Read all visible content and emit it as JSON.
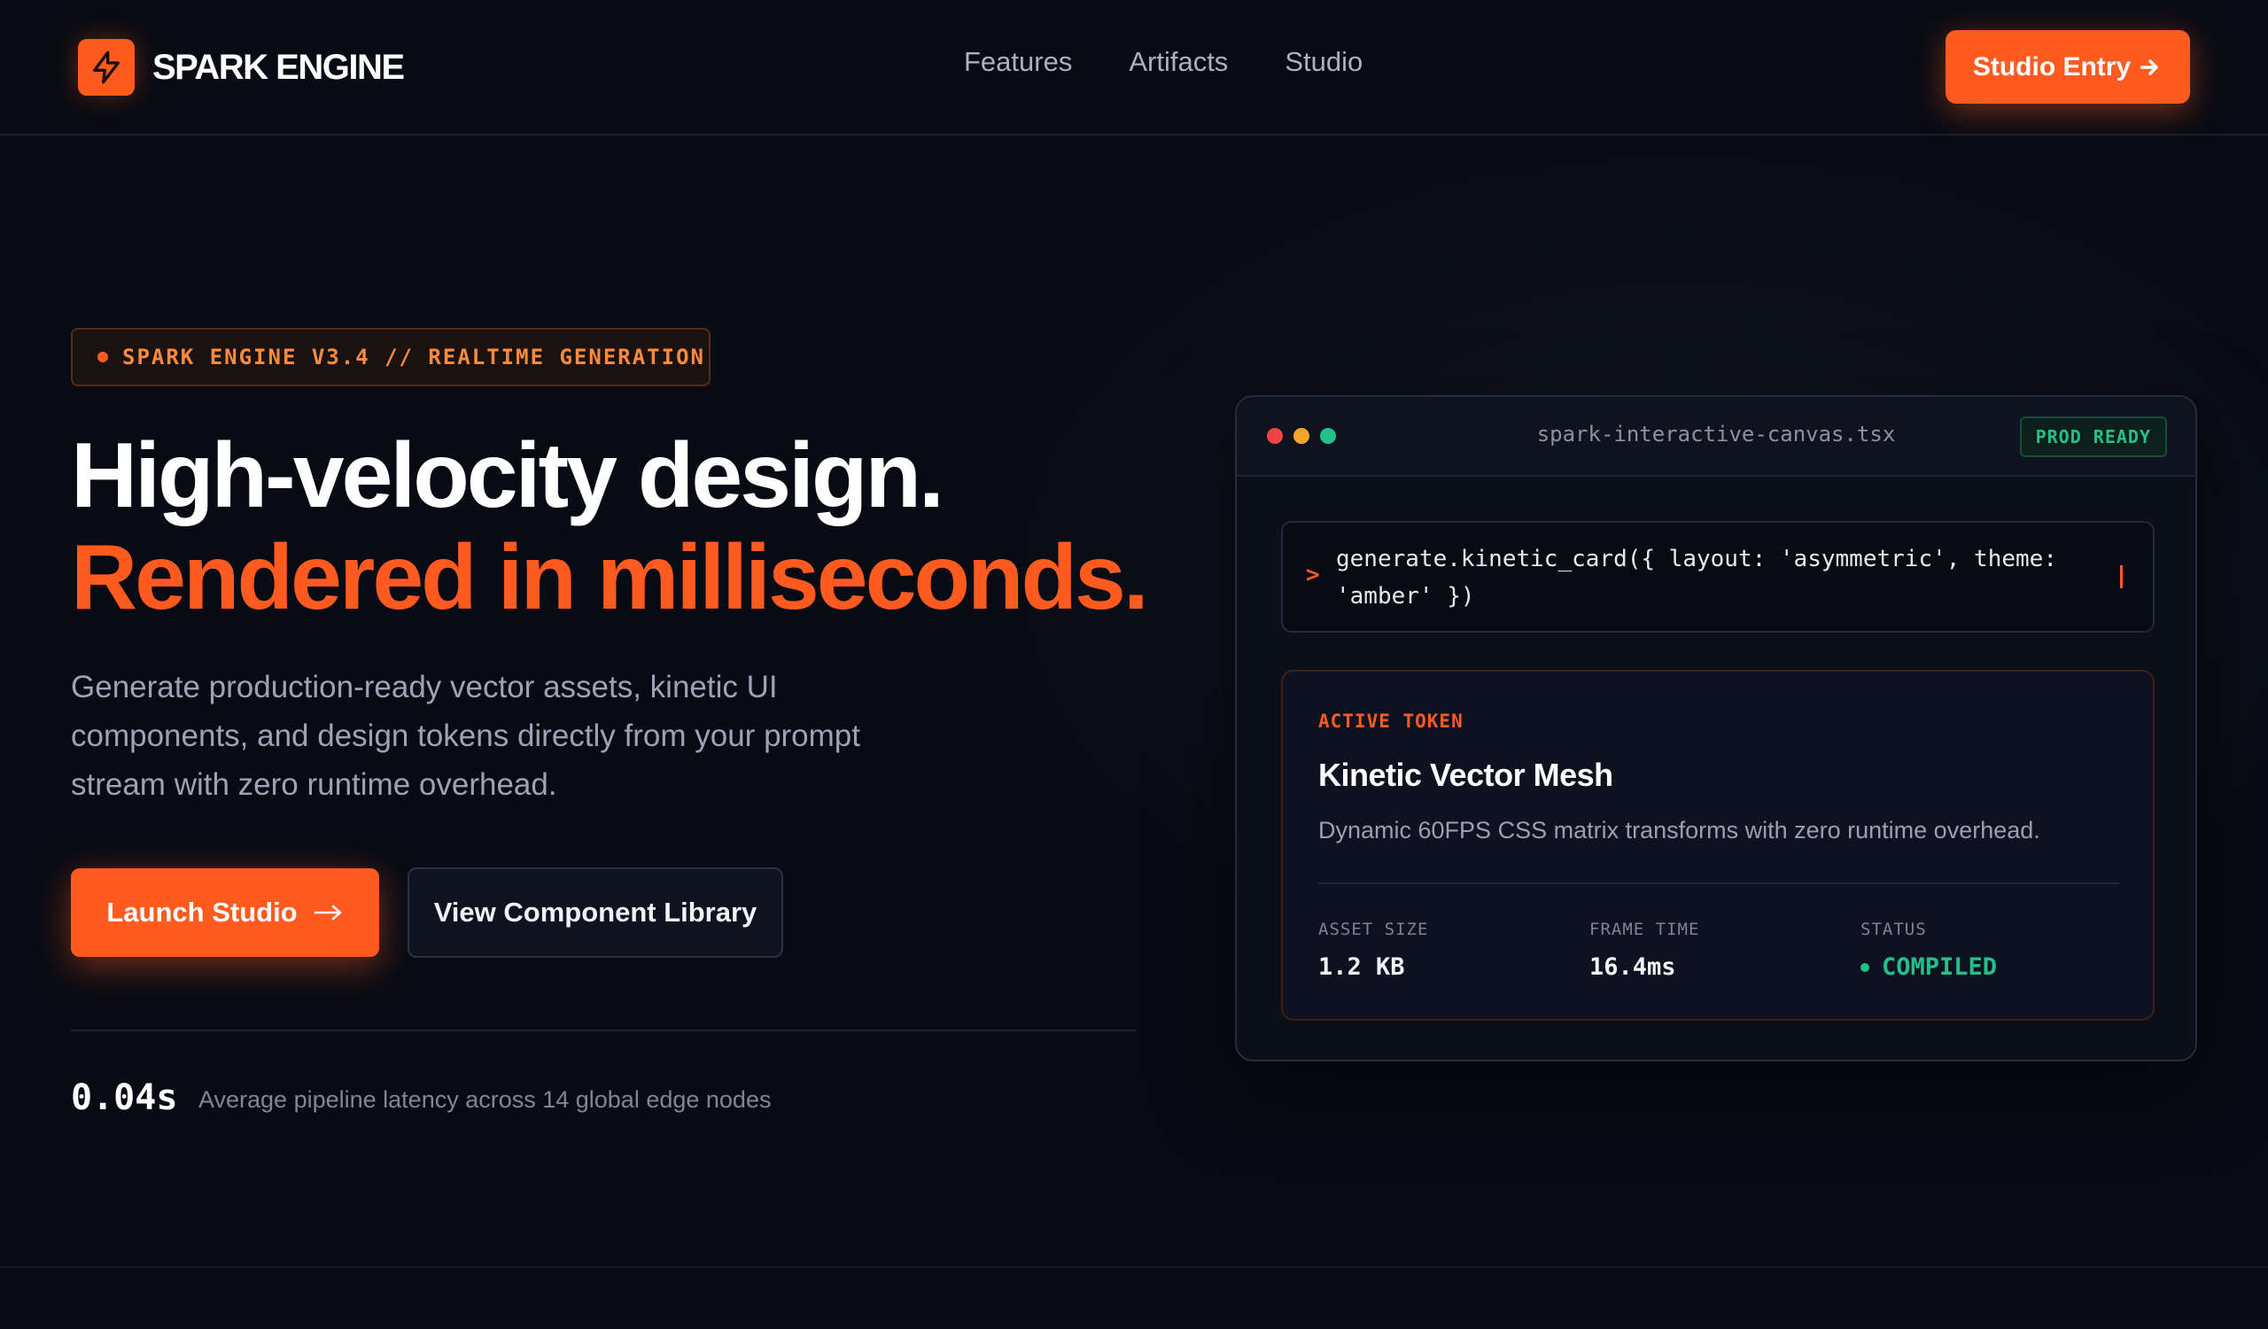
{
  "nav": {
    "brand": "SPARK ENGINE",
    "links": [
      "Features",
      "Artifacts",
      "Studio"
    ],
    "cta": "Studio Entry",
    "cta_icon": "arrow-right-icon"
  },
  "hero": {
    "badge": "SPARK ENGINE V3.4 // REALTIME GENERATION",
    "headline_line1": "High-velocity design.",
    "headline_line2": "Rendered in milliseconds.",
    "lead": "Generate production-ready vector assets, kinetic UI components, and design tokens directly from your prompt stream with zero runtime overhead.",
    "primary_button": "Launch Studio",
    "secondary_button": "View Component Library",
    "stat_value": "0.04s",
    "stat_label": "Average pipeline latency across 14 global edge nodes"
  },
  "canvas": {
    "filename": "spark-interactive-canvas.tsx",
    "status_badge": "PROD READY",
    "prompt_symbol": ">",
    "prompt": "generate.kinetic_card({ layout: 'asymmetric', theme: 'amber' })",
    "token": {
      "kicker": "ACTIVE TOKEN",
      "title": "Kinetic Vector Mesh",
      "description": "Dynamic 60FPS CSS matrix transforms with zero runtime overhead.",
      "metrics": [
        {
          "label": "ASSET SIZE",
          "value": "1.2 KB"
        },
        {
          "label": "FRAME TIME",
          "value": "16.4ms"
        },
        {
          "label": "STATUS",
          "value": "COMPILED"
        }
      ]
    }
  },
  "colors": {
    "accent": "#ff5a1f",
    "background": "#080b13",
    "success": "#22c08a"
  },
  "icons": {
    "brand": "lightning-bolt-icon"
  }
}
